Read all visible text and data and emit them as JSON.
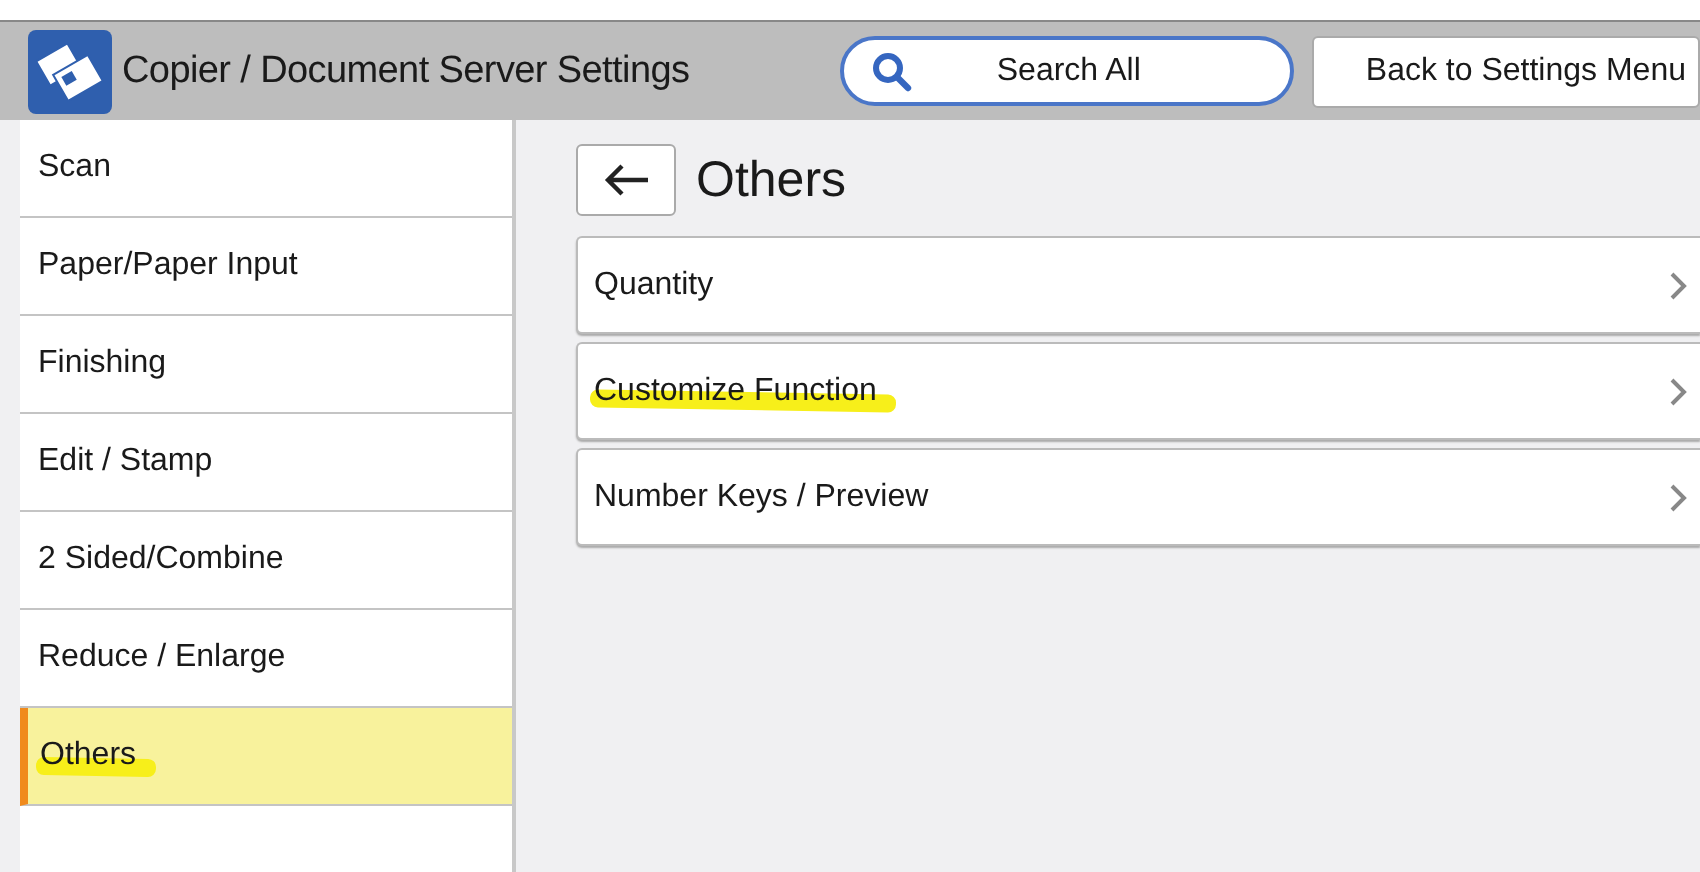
{
  "header": {
    "title": "Copier / Document Server Settings",
    "search_button": "Search All",
    "back_button": "Back to Settings Menu"
  },
  "sidebar": {
    "items": [
      {
        "label": "Scan",
        "selected": false,
        "highlighted": false
      },
      {
        "label": "Paper/Paper Input",
        "selected": false,
        "highlighted": false
      },
      {
        "label": "Finishing",
        "selected": false,
        "highlighted": false
      },
      {
        "label": "Edit / Stamp",
        "selected": false,
        "highlighted": false
      },
      {
        "label": "2 Sided/Combine",
        "selected": false,
        "highlighted": false
      },
      {
        "label": "Reduce / Enlarge",
        "selected": false,
        "highlighted": false
      },
      {
        "label": "Others",
        "selected": true,
        "highlighted": true
      }
    ]
  },
  "main": {
    "title": "Others",
    "items": [
      {
        "label": "Quantity",
        "highlighted": false
      },
      {
        "label": "Customize Function",
        "highlighted": true
      },
      {
        "label": "Number Keys / Preview",
        "highlighted": false
      }
    ]
  }
}
